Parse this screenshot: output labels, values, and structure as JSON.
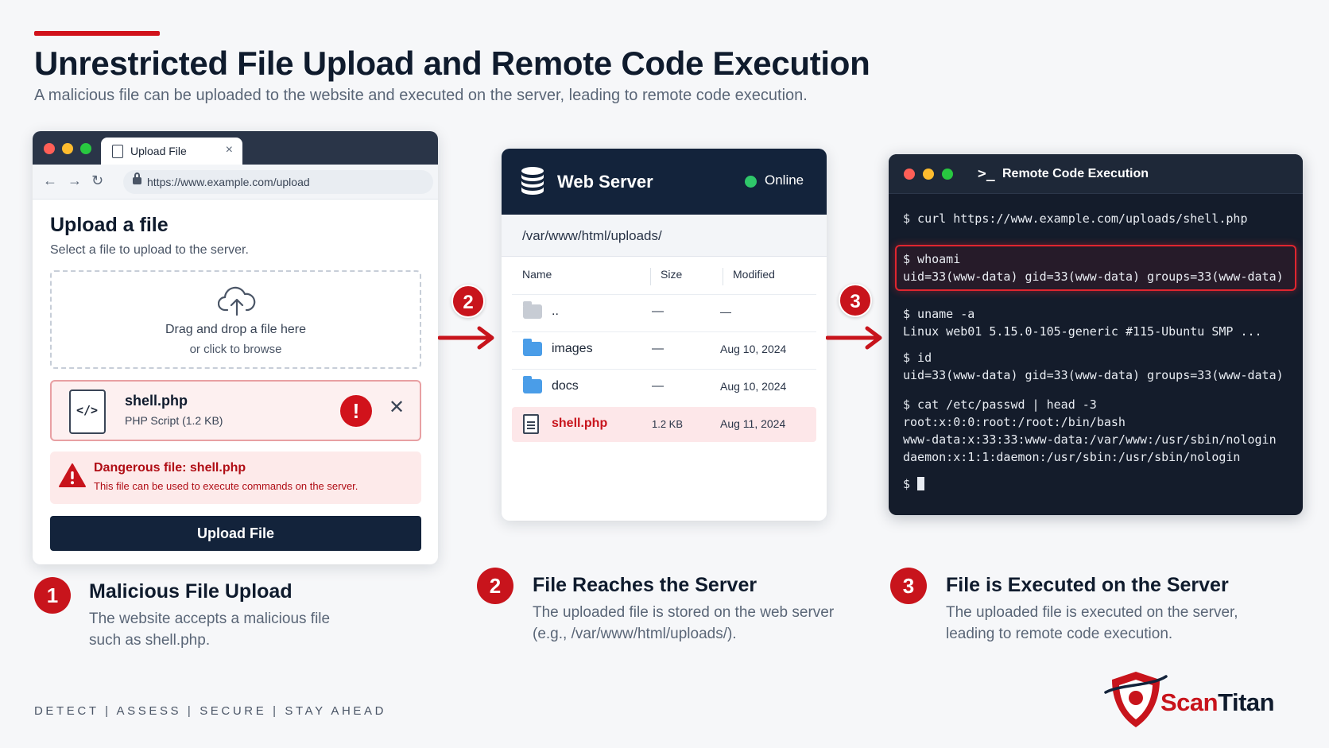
{
  "header": {
    "title": "Unrestricted File Upload and Remote Code Execution",
    "subtitle": "A malicious file can be uploaded to the website and executed on the server, leading to remote code execution."
  },
  "colors": {
    "accent": "#c8141c",
    "navy": "#13233b",
    "terminal_bg": "#141c2b",
    "online": "#2fc76a"
  },
  "browser": {
    "tab_label": "Upload File",
    "tab_close": "×",
    "url": "https://www.example.com/upload",
    "heading": "Upload a file",
    "subheading": "Select a file to upload to the server.",
    "dropzone": {
      "line1": "Drag and drop a file here",
      "line2": "or click to browse",
      "icon": "cloud-upload-icon"
    },
    "file": {
      "name": "shell.php",
      "meta": "PHP Script (1.2 KB)",
      "icon": "code-file-icon",
      "alert": "!",
      "close": "✕"
    },
    "warning": {
      "title": "Dangerous file: shell.php",
      "text": "This file can be used to execute commands on the server."
    },
    "upload_button": "Upload File"
  },
  "server": {
    "title": "Web Server",
    "status": "Online",
    "path": "/var/www/html/uploads/",
    "columns": [
      "Name",
      "Size",
      "Modified"
    ],
    "rows": [
      {
        "name": "..",
        "size": "—",
        "modified": "—"
      },
      {
        "name": "images",
        "size": "—",
        "modified": "Aug 10, 2024"
      },
      {
        "name": "docs",
        "size": "—",
        "modified": "Aug 10, 2024"
      },
      {
        "name": "shell.php",
        "size": "1.2 KB",
        "modified": "Aug 11, 2024"
      }
    ]
  },
  "terminal": {
    "icon": ">_",
    "title": "Remote Code Execution",
    "lines": [
      "$ curl https://www.example.com/uploads/shell.php",
      "$ whoami",
      "uid=33(www-data) gid=33(www-data) groups=33(www-data)",
      "$ uname -a",
      "Linux web01 5.15.0-105-generic #115-Ubuntu SMP ...",
      "$ id",
      "uid=33(www-data) gid=33(www-data) groups=33(www-data)",
      "$ cat /etc/passwd | head -3",
      "root:x:0:0:root:/root:/bin/bash",
      "www-data:x:33:33:www-data:/var/www:/usr/sbin/nologin",
      "daemon:x:1:1:daemon:/usr/sbin:/usr/sbin/nologin",
      "$ "
    ]
  },
  "arrows": {
    "badge1": "2",
    "badge2": "3"
  },
  "steps": [
    {
      "num": "1",
      "title": "Malicious File Upload",
      "desc1": "The website accepts a malicious file",
      "desc2": "such as shell.php."
    },
    {
      "num": "2",
      "title": "File  Reaches the Server",
      "desc1": "The uploaded file is stored on the web server",
      "desc2": "(e.g., /var/www/html/uploads/)."
    },
    {
      "num": "3",
      "title": "File is Executed on the Server",
      "desc1": "The uploaded file is executed on the server,",
      "desc2": "leading to remote code execution."
    }
  ],
  "footer": {
    "tagline": "DETECT  |  ASSESS  |  SECURE  |  STAY AHEAD",
    "logo_part1": "Scan",
    "logo_part2": "Titan"
  }
}
